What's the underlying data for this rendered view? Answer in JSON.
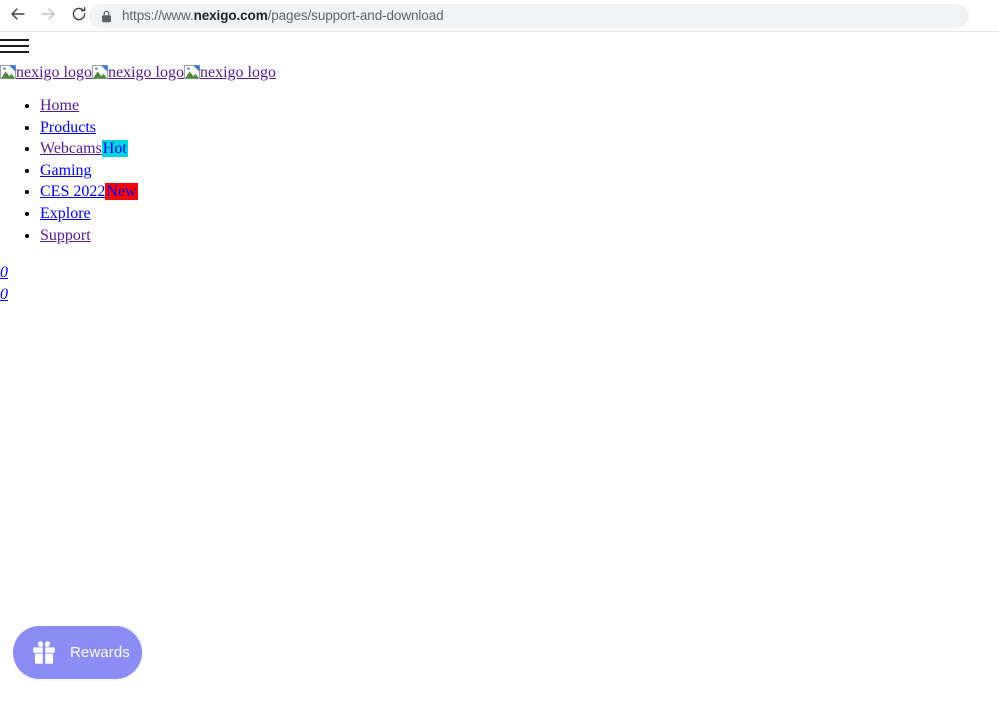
{
  "browser": {
    "back_icon": "arrow-left-icon",
    "forward_icon": "arrow-right-icon",
    "reload_icon": "reload-icon",
    "lock_icon": "lock-icon",
    "url_scheme": "https://www.",
    "url_host": "nexigo.com",
    "url_path": "/pages/support-and-download",
    "url_full": "https://www.nexigo.com/pages/support-and-download"
  },
  "page": {
    "menu_toggle_icon": "hamburger-menu-icon",
    "logos": [
      {
        "alt": "nexigo logo",
        "icon": "broken-image-icon"
      },
      {
        "alt": "nexigo logo",
        "icon": "broken-image-icon"
      },
      {
        "alt": "nexigo logo",
        "icon": "broken-image-icon"
      }
    ],
    "nav": [
      {
        "label": "Home",
        "visited": true,
        "badge": null
      },
      {
        "label": "Products",
        "visited": false,
        "badge": null
      },
      {
        "label": "Webcams",
        "visited": true,
        "badge": "Hot"
      },
      {
        "label": "Gaming",
        "visited": false,
        "badge": null
      },
      {
        "label": "CES 2022",
        "visited": false,
        "badge": "New"
      },
      {
        "label": "Explore",
        "visited": false,
        "badge": null
      },
      {
        "label": "Support",
        "visited": true,
        "badge": null
      }
    ],
    "counters": [
      {
        "label": "0",
        "name": "wishlist-count-link"
      },
      {
        "label": "0",
        "name": "cart-count-link"
      }
    ]
  },
  "rewards": {
    "label": "Rewards",
    "icon": "gift-icon",
    "color": "#8a8df5"
  },
  "colors": {
    "link": "#0000ee",
    "link_visited": "#551a8b",
    "badge_hot_bg": "#00d5e0",
    "badge_new_bg": "#fa0000",
    "rewards_bg": "#8a8df5",
    "omnibox_bg": "#f1f3f4",
    "url_host_text": "#202124",
    "url_dim_text": "#5f6368"
  }
}
